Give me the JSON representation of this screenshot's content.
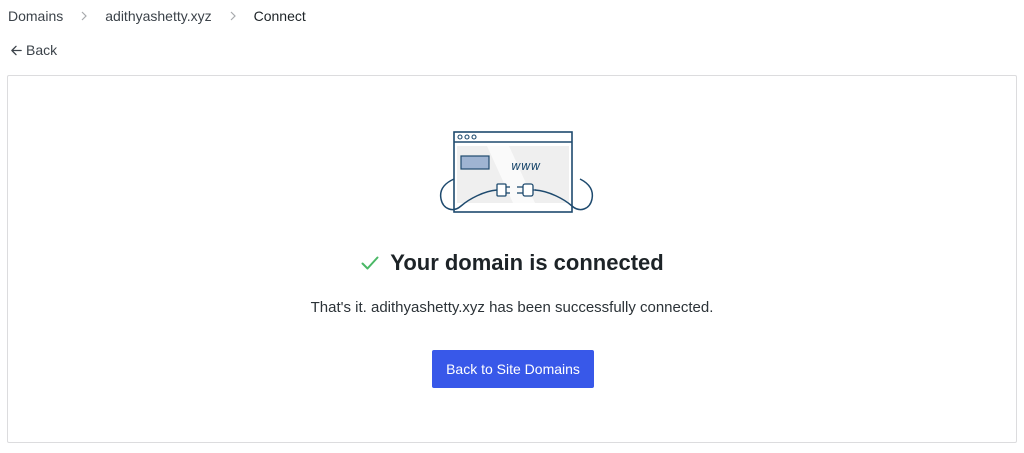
{
  "breadcrumb": {
    "items": [
      "Domains",
      "adithyashetty.xyz",
      "Connect"
    ],
    "separator_icon": "chevron-right-icon"
  },
  "back": {
    "label": "Back",
    "icon": "arrow-left-icon"
  },
  "main": {
    "illustration": {
      "text": "www",
      "icon": "browser-plug-illustration"
    },
    "title": "Your domain is connected",
    "status_icon": "checkmark-icon",
    "description": "That's it. adithyashetty.xyz has been successfully connected.",
    "button_label": "Back to Site Domains"
  },
  "colors": {
    "primary": "#3858e9",
    "success": "#4ab866",
    "border": "#dcdcde",
    "illustration_stroke": "#1e4a6e"
  }
}
